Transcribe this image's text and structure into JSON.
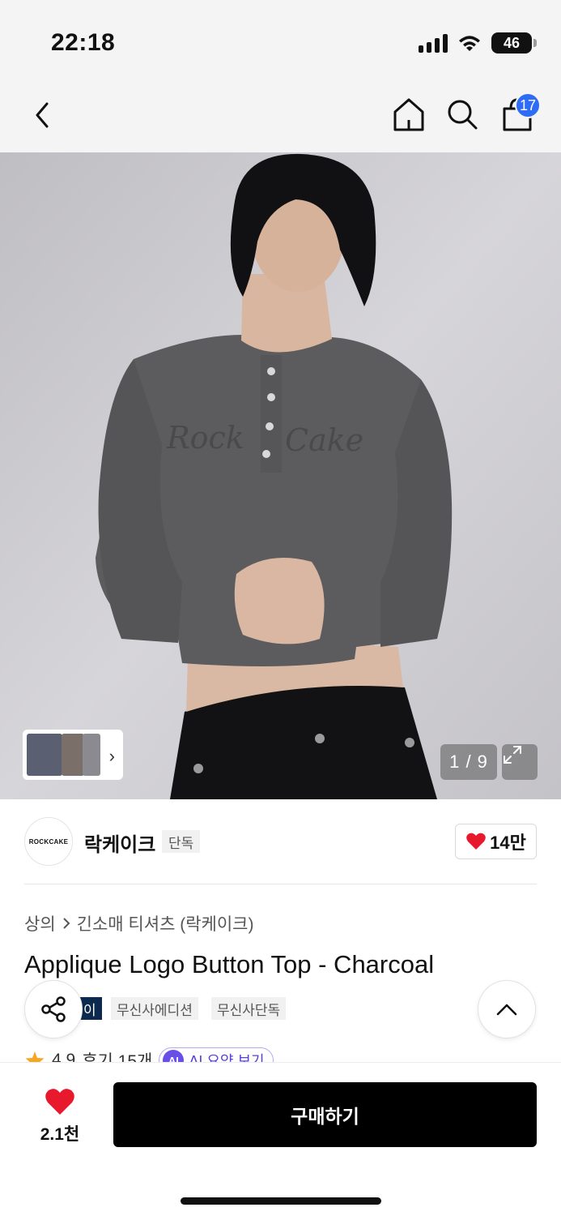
{
  "status_bar": {
    "time": "22:18",
    "battery": "46"
  },
  "nav": {
    "cart_count": "17"
  },
  "gallery": {
    "counter": "1 / 9"
  },
  "brand": {
    "logo_text": "ROCKCAKE",
    "name": "락케이크",
    "tag": "단독",
    "likes": "14만"
  },
  "breadcrumb": {
    "category": "상의",
    "subcategory": "긴소매 티셔츠 (락케이크)"
  },
  "product": {
    "title": "Applique Logo Button Top - Charcoal"
  },
  "tags": [
    "이",
    "무신사에디션",
    "무신사단독"
  ],
  "review": {
    "rating": "4.9",
    "count": "후기 15개",
    "ai_badge": "AI",
    "ai_label": "AI 요약 보기"
  },
  "bottom": {
    "wish_count": "2.1천",
    "buy_label": "구매하기"
  },
  "colors": {
    "accent_blue": "#2f6cf5",
    "heart_red": "#e8192c",
    "buy_black": "#000000",
    "ai_purple": "#6a4ee8",
    "tag_navy": "#0d2a4e"
  },
  "icons": [
    "back-chevron-icon",
    "home-icon",
    "search-icon",
    "shopping-bag-icon",
    "expand-icon",
    "heart-icon",
    "share-icon",
    "chevron-up-icon",
    "star-icon"
  ]
}
